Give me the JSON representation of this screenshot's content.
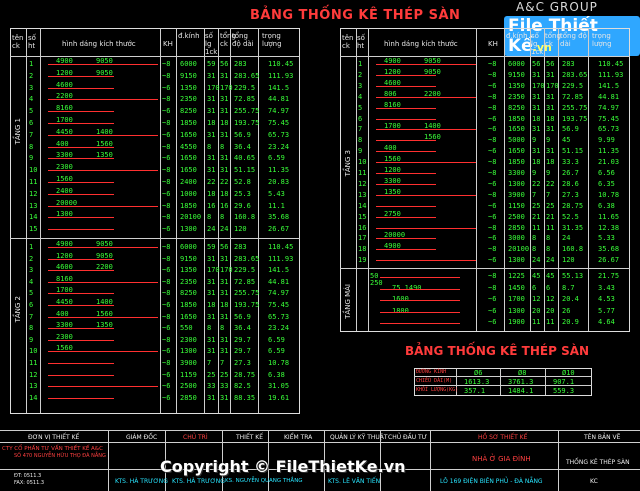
{
  "header": {
    "brand": "A&C GROUP",
    "logo_main": "File Thiết Kế",
    "logo_suffix": ".vn",
    "title_left": "BẢNG THỐNG KÊ THÉP SÀN",
    "title_right_bottom": "BẢNG THỐNG KÊ THÉP SÀN"
  },
  "columns": {
    "left": [
      "tên ck",
      "số ht",
      "hình dáng kích thước",
      "KH",
      "đ.kính",
      "số lg 1ck",
      "tổng ck",
      "tổng độ dài",
      "trọng lượng"
    ],
    "right": [
      "tên ck",
      "số ht",
      "hình dáng kích thước",
      "KH",
      "đ.kính",
      "số lg 1ck",
      "tổng ck",
      "tổng độ dài",
      "trọng lượng"
    ]
  },
  "floors": {
    "t1": "TẦNG 1",
    "t2": "TẦNG 2",
    "t3": "TẦNG 3",
    "tm": "TẦNG MÁI"
  },
  "left_upper_rows": [
    [
      "4900",
      "9050",
      "8",
      "6000",
      "59",
      "56",
      "283",
      "110.45"
    ],
    [
      "1200",
      "9050",
      "8",
      "9150",
      "31",
      "31",
      "283.65",
      "111.93"
    ],
    [
      "4600",
      "",
      "6",
      "1350",
      "170",
      "170",
      "229.5",
      "141.5"
    ],
    [
      "2200",
      "",
      "8",
      "2350",
      "31",
      "31",
      "72.85",
      "44.81"
    ],
    [
      "8160",
      "",
      "6",
      "8250",
      "31",
      "31",
      "255.75",
      "74.97"
    ],
    [
      "1700",
      "",
      "8",
      "1850",
      "18",
      "18",
      "193.75",
      "75.45"
    ],
    [
      "4450",
      "1400",
      "6",
      "1650",
      "31",
      "31",
      "56.9",
      "65.73"
    ],
    [
      "400",
      "1560",
      "8",
      "4550",
      "8",
      "8",
      "36.4",
      "23.24"
    ],
    [
      "3300",
      "1350",
      "6",
      "1650",
      "31",
      "31",
      "40.65",
      "6.59"
    ],
    [
      "2300",
      "",
      "8",
      "1650",
      "31",
      "31",
      "51.15",
      "11.35"
    ],
    [
      "1560",
      "",
      "8",
      "2400",
      "22",
      "22",
      "52.8",
      "20.83"
    ],
    [
      "2400",
      "",
      "6",
      "1000",
      "18",
      "18",
      "25.3",
      "5.43"
    ],
    [
      "20000",
      "",
      "8",
      "1850",
      "16",
      "16",
      "29.6",
      "11.1"
    ],
    [
      "1300",
      "",
      "8",
      "20100",
      "8",
      "8",
      "160.8",
      "35.68"
    ],
    [
      "",
      "",
      "6",
      "1300",
      "24",
      "24",
      "120",
      "26.67"
    ]
  ],
  "left_lower_rows": [
    [
      "4900",
      "9050",
      "8",
      "6000",
      "59",
      "56",
      "283",
      "110.45"
    ],
    [
      "1200",
      "9050",
      "8",
      "9150",
      "31",
      "31",
      "283.65",
      "111.93"
    ],
    [
      "4600",
      "2200",
      "6",
      "1350",
      "170",
      "170",
      "229.5",
      "141.5"
    ],
    [
      "8160",
      "",
      "8",
      "2350",
      "31",
      "31",
      "72.85",
      "44.81"
    ],
    [
      "1700",
      "",
      "8",
      "8250",
      "31",
      "31",
      "255.75",
      "74.97"
    ],
    [
      "4450",
      "1400",
      "6",
      "1850",
      "18",
      "18",
      "193.75",
      "75.45"
    ],
    [
      "400",
      "1560",
      "8",
      "1650",
      "31",
      "31",
      "56.9",
      "65.73"
    ],
    [
      "3300",
      "1350",
      "6",
      "550",
      "8",
      "8",
      "36.4",
      "23.24"
    ],
    [
      "2300",
      "",
      "8",
      "2300",
      "31",
      "31",
      "29.7",
      "6.59"
    ],
    [
      "1560",
      "",
      "6",
      "1300",
      "31",
      "31",
      "29.7",
      "6.59"
    ],
    [
      "",
      "",
      "8",
      "3900",
      "7",
      "7",
      "27.3",
      "10.78"
    ],
    [
      "",
      "",
      "6",
      "1159",
      "25",
      "25",
      "28.75",
      "6.38"
    ],
    [
      "",
      "",
      "6",
      "2500",
      "33",
      "33",
      "82.5",
      "31.05"
    ],
    [
      "",
      "",
      "6",
      "2850",
      "31",
      "31",
      "88.35",
      "19.61"
    ]
  ],
  "right_rows": [
    [
      "4900",
      "9050",
      "8",
      "6000",
      "56",
      "56",
      "283",
      "110.45"
    ],
    [
      "1200",
      "9050",
      "8",
      "9150",
      "31",
      "31",
      "283.65",
      "111.93"
    ],
    [
      "4600",
      "",
      "6",
      "1350",
      "170",
      "170",
      "229.5",
      "141.5"
    ],
    [
      "806",
      "2200",
      "8",
      "2350",
      "31",
      "31",
      "72.85",
      "44.81"
    ],
    [
      "8160",
      "",
      "8",
      "8250",
      "31",
      "31",
      "255.75",
      "74.97"
    ],
    [
      "",
      "",
      "6",
      "1850",
      "18",
      "18",
      "193.75",
      "75.45"
    ],
    [
      "1700",
      "1400",
      "6",
      "1650",
      "31",
      "31",
      "56.9",
      "65.73"
    ],
    [
      "",
      "1560",
      "8",
      "5000",
      "9",
      "9",
      "45",
      "9.99"
    ],
    [
      "400",
      "",
      "6",
      "1650",
      "31",
      "31",
      "51.15",
      "11.35"
    ],
    [
      "1560",
      "",
      "8",
      "1850",
      "18",
      "18",
      "33.3",
      "21.03"
    ],
    [
      "1200",
      "",
      "8",
      "3300",
      "9",
      "9",
      "26.7",
      "6.56"
    ],
    [
      "3300",
      "",
      "6",
      "1300",
      "22",
      "22",
      "28.6",
      "6.35"
    ],
    [
      "1350",
      "",
      "8",
      "3900",
      "7",
      "7",
      "27.3",
      "10.78"
    ],
    [
      "",
      "",
      "6",
      "1150",
      "25",
      "25",
      "28.75",
      "6.38"
    ],
    [
      "2750",
      "",
      "6",
      "2500",
      "21",
      "21",
      "52.5",
      "11.65"
    ],
    [
      "",
      "",
      "8",
      "2850",
      "11",
      "11",
      "31.35",
      "12.38"
    ],
    [
      "20000",
      "",
      "6",
      "3000",
      "8",
      "8",
      "24",
      "5.33"
    ],
    [
      "4900",
      "",
      "8",
      "20100",
      "8",
      "8",
      "160.8",
      "35.68"
    ],
    [
      "",
      "",
      "6",
      "1300",
      "24",
      "24",
      "120",
      "26.67"
    ]
  ],
  "roof_rows": [
    [
      "50",
      "250",
      "",
      "8",
      "1225",
      "45",
      "45",
      "55.13",
      "21.75"
    ],
    [
      "",
      "",
      "75 1490",
      "8",
      "1450",
      "6",
      "6",
      "8.7",
      "3.43"
    ],
    [
      "",
      "",
      "1600",
      "6",
      "1700",
      "12",
      "12",
      "20.4",
      "4.53"
    ],
    [
      "",
      "",
      "1800",
      "6",
      "1300",
      "20",
      "20",
      "26",
      "5.77"
    ],
    [
      "",
      "",
      "",
      "6",
      "1900",
      "11",
      "11",
      "20.9",
      "4.64"
    ]
  ],
  "summary": {
    "headers": [
      "ĐƯỜNG KÍNH",
      "Ø6",
      "Ø8",
      "Ø10"
    ],
    "row1_label": "CHIỀU DÀI(M)",
    "row1": [
      "1613.3",
      "3761.3",
      "907.1"
    ],
    "row2_label": "KHỐI LƯỢNG(KG)",
    "row2": [
      "357.1",
      "1484.1",
      "559.3"
    ]
  },
  "footer": {
    "company": "CTY CỔ PHẦN TƯ VẤN THIẾT KẾ A&C",
    "address": "SỐ 470 NGUYỄN HỮU THỌ ĐÀ NẴNG",
    "phone": "ĐT: 0511.3",
    "fax": "FAX: 0511.3",
    "unit_label": "ĐƠN VỊ THIẾT KẾ",
    "director_label": "GIÁM ĐỐC",
    "chief_label": "CHỦ TRÌ",
    "design_label": "THIẾT KẾ",
    "check_label": "KIỂM TRA",
    "manage_label": "QUẢN LÝ KỸ THUẬT",
    "investor_label": "CHỦ ĐẦU TƯ",
    "project_label": "HỒ SƠ THIẾT KẾ",
    "drawing_label": "TÊN BẢN VẼ",
    "director": "KTS. HÀ TRƯƠNG",
    "chief": "KTS. HÀ TRƯƠNG",
    "designer": "KS. NGUYỄN QUANG THẮNG",
    "checker": "KTS. LÊ VĂN TIẾN",
    "project": "NHÀ Ở GIA ĐÌNH",
    "location": "LÔ 169 ĐIỆN BIÊN PHỦ - ĐÀ NẴNG",
    "drawing": "THỐNG KÊ THÉP SÀN",
    "sheet": "KC"
  },
  "watermark": "Copyright © FileThietKe.vn"
}
